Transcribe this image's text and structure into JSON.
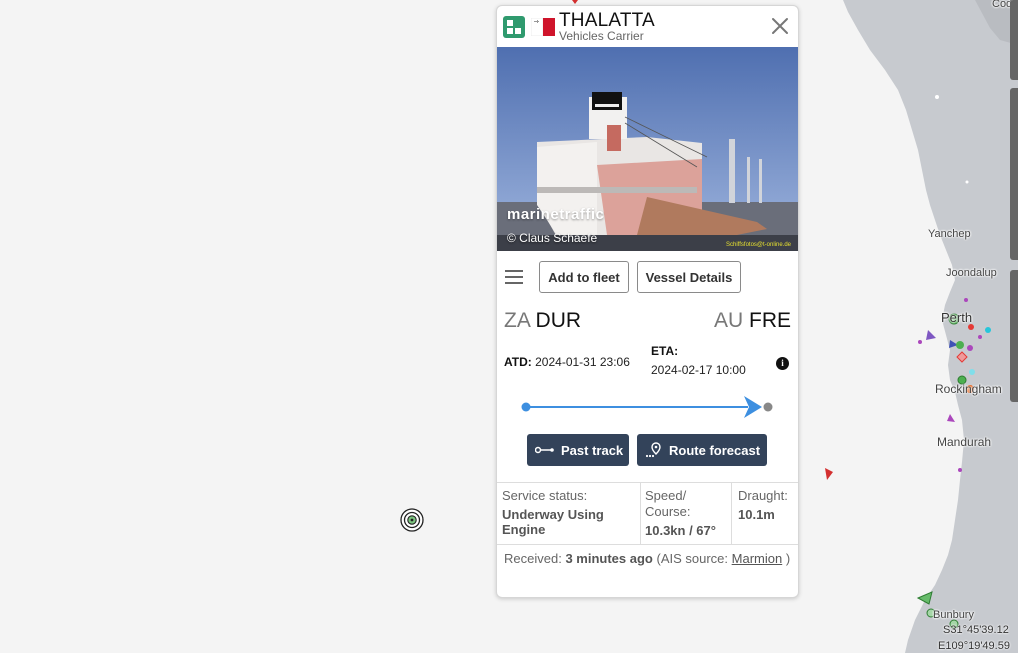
{
  "map": {
    "places": [
      "Yanchep",
      "Joondalup",
      "Perth",
      "Rockingham",
      "Mandurah",
      "Bunbury",
      "Cod"
    ],
    "coords": {
      "lat": "S31°45'39.12",
      "lon": "E109°19'49.59"
    },
    "colors": {
      "sea": "#f4f4f4",
      "land": "#c7cacf",
      "accent": "#d6d8dc"
    }
  },
  "popup": {
    "ship_name": "THALATTA",
    "ship_type": "Vehicles Carrier",
    "flag": "Malta",
    "photo": {
      "watermark": "marinetraffic",
      "credit": "© Claus Schaefe",
      "credit2": "Schiffsfotos@t-online.de"
    },
    "toolbar": {
      "add_to_fleet": "Add to fleet",
      "vessel_details": "Vessel Details"
    },
    "departure": {
      "country": "ZA",
      "port": "DUR",
      "label": "ATD:",
      "time": "2024-01-31 23:06"
    },
    "arrival": {
      "country": "AU",
      "port": "FRE",
      "label": "ETA:",
      "time": "2024-02-17 10:00"
    },
    "progress": 1,
    "buttons": {
      "past_track": "Past track",
      "route_forecast": "Route forecast"
    },
    "status": {
      "service_label": "Service status:",
      "service_value": "Underway Using Engine",
      "speed_label": "Speed/ Course:",
      "speed_value": "10.3kn / 67°",
      "draught_label": "Draught:",
      "draught_value": "10.1m"
    },
    "received": {
      "prefix": "Received:",
      "age": "3 minutes ago",
      "source_prefix": "(AIS source:",
      "source": "Marmion",
      "suffix": ")"
    },
    "colors": {
      "type_icon": "#2f9a6e",
      "buttons_dark": "#33435a",
      "progress": "#3d8fe0"
    }
  }
}
